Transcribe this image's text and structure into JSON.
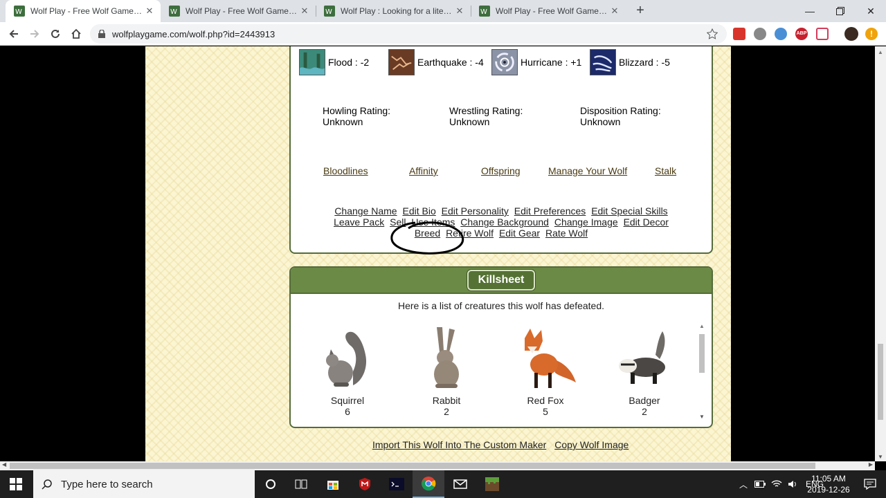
{
  "browser": {
    "tabs": [
      {
        "title": "Wolf Play - Free Wolf Game! | Wo",
        "active": true
      },
      {
        "title": "Wolf Play - Free Wolf Game! | Wo",
        "active": false
      },
      {
        "title": "Wolf Play : Looking for a literate",
        "active": false
      },
      {
        "title": "Wolf Play - Free Wolf Game! | Wo",
        "active": false
      }
    ],
    "url": "wolfplaygame.com/wolf.php?id=2443913"
  },
  "disasters": [
    {
      "label": "Flood : -2",
      "icon": "flood-icon"
    },
    {
      "label": "Earthquake : -4",
      "icon": "earthquake-icon"
    },
    {
      "label": "Hurricane : +1",
      "icon": "hurricane-icon"
    },
    {
      "label": "Blizzard : -5",
      "icon": "blizzard-icon"
    }
  ],
  "ratings": [
    {
      "label": "Howling Rating:",
      "value": "Unknown"
    },
    {
      "label": "Wrestling Rating:",
      "value": "Unknown"
    },
    {
      "label": "Disposition Rating:",
      "value": "Unknown"
    }
  ],
  "main_links": [
    "Bloodlines",
    "Affinity",
    "Offspring",
    "Manage Your Wolf",
    "Stalk"
  ],
  "edit_links": {
    "row1": [
      "Change Name",
      "Edit Bio",
      "Edit Personality",
      "Edit Preferences",
      "Edit Special Skills"
    ],
    "row2": [
      "Leave Pack",
      "Sell",
      "Use Items",
      "Change Background",
      "Change Image",
      "Edit Decor"
    ],
    "row3": [
      "Breed",
      "Retire Wolf",
      "Edit Gear",
      "Rate Wolf"
    ]
  },
  "killsheet": {
    "title": "Killsheet",
    "description": "Here is a list of creatures this wolf has defeated.",
    "creatures": [
      {
        "name": "Squirrel",
        "count": "6"
      },
      {
        "name": "Rabbit",
        "count": "2"
      },
      {
        "name": "Red Fox",
        "count": "5"
      },
      {
        "name": "Badger",
        "count": "2"
      }
    ]
  },
  "footer_links": [
    "Import This Wolf Into The Custom Maker",
    "Copy Wolf Image"
  ],
  "taskbar": {
    "search_placeholder": "Type here to search",
    "language": "ENG",
    "time": "11:05 AM",
    "date": "2019-12-26"
  }
}
